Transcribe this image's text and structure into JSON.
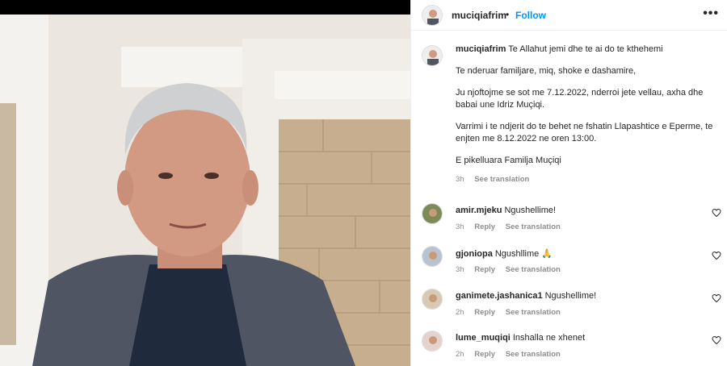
{
  "post": {
    "username": "muciqiafrim",
    "separator": "•",
    "follow_label": "Follow",
    "more_label": "•••"
  },
  "caption": {
    "username": "muciqiafrim",
    "line1": "Te Allahut jemi dhe te ai do te kthehemi",
    "para1": "Te nderuar familjare, miq, shoke e dashamire,",
    "para2": "Ju njoftojme se sot me 7.12.2022, nderroi jete vellau, axha dhe babai une Idriz Muçiqi.",
    "para3": "Varrimi i te ndjerit do te behet ne fshatin Llapashtice e Eperme, te enjten me 8.12.2022 ne oren 13:00.",
    "para4": "E pikelluara Familja Muçiqi",
    "time": "3h",
    "see_translation": "See translation"
  },
  "comments": [
    {
      "username": "amir.mjeku",
      "text": "Ngushellime!",
      "time": "3h",
      "reply": "Reply",
      "see_translation": "See translation"
    },
    {
      "username": "gjoniopa",
      "text": "Ngushllime 🙏",
      "time": "3h",
      "reply": "Reply",
      "see_translation": "See translation"
    },
    {
      "username": "ganimete.jashanica1",
      "text": "Ngushellime!",
      "time": "2h",
      "reply": "Reply",
      "see_translation": "See translation"
    },
    {
      "username": "lume_muqiqi",
      "text": "Inshalla ne xhenet",
      "time": "2h",
      "reply": "Reply",
      "see_translation": "See translation"
    }
  ],
  "colors": {
    "accent": "#0095f6",
    "muted": "#8e8e8e",
    "text": "#262626"
  },
  "icons": [
    "more-options-icon",
    "heart-icon"
  ]
}
